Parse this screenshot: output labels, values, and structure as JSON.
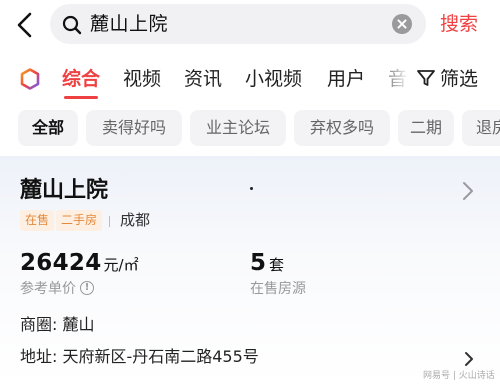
{
  "search": {
    "query": "麓山上院",
    "submit_label": "搜索"
  },
  "tabs": [
    {
      "label": "综合",
      "active": true
    },
    {
      "label": "视频",
      "active": false
    },
    {
      "label": "资讯",
      "active": false
    },
    {
      "label": "小视频",
      "active": false
    },
    {
      "label": "用户",
      "active": false
    },
    {
      "label": "音",
      "active": false
    }
  ],
  "filter_label": "筛选",
  "chips": [
    {
      "label": "全部",
      "active": true
    },
    {
      "label": "卖得好吗",
      "active": false
    },
    {
      "label": "业主论坛",
      "active": false
    },
    {
      "label": "弃权多吗",
      "active": false
    },
    {
      "label": "二期",
      "active": false
    },
    {
      "label": "退房",
      "active": false
    }
  ],
  "listing": {
    "name": "麓山上院",
    "tags": [
      "在售",
      "二手房"
    ],
    "city": "成都",
    "price_value": "26424",
    "price_unit": "元/㎡",
    "price_label": "参考单价",
    "count_value": "5",
    "count_unit": "套",
    "count_label": "在售房源",
    "district": "商圈: 麓山",
    "address": "地址: 天府新区-丹石南二路455号"
  },
  "watermark": "网易号 | 火山诗话",
  "colors": {
    "accent": "#f04142",
    "tag_bg": "#fdf0e2",
    "tag_text": "#e5893c"
  },
  "icons": [
    "back-arrow-icon",
    "search-icon",
    "clear-icon",
    "brand-logo-icon",
    "filter-icon",
    "chevron-right-icon",
    "info-icon"
  ]
}
